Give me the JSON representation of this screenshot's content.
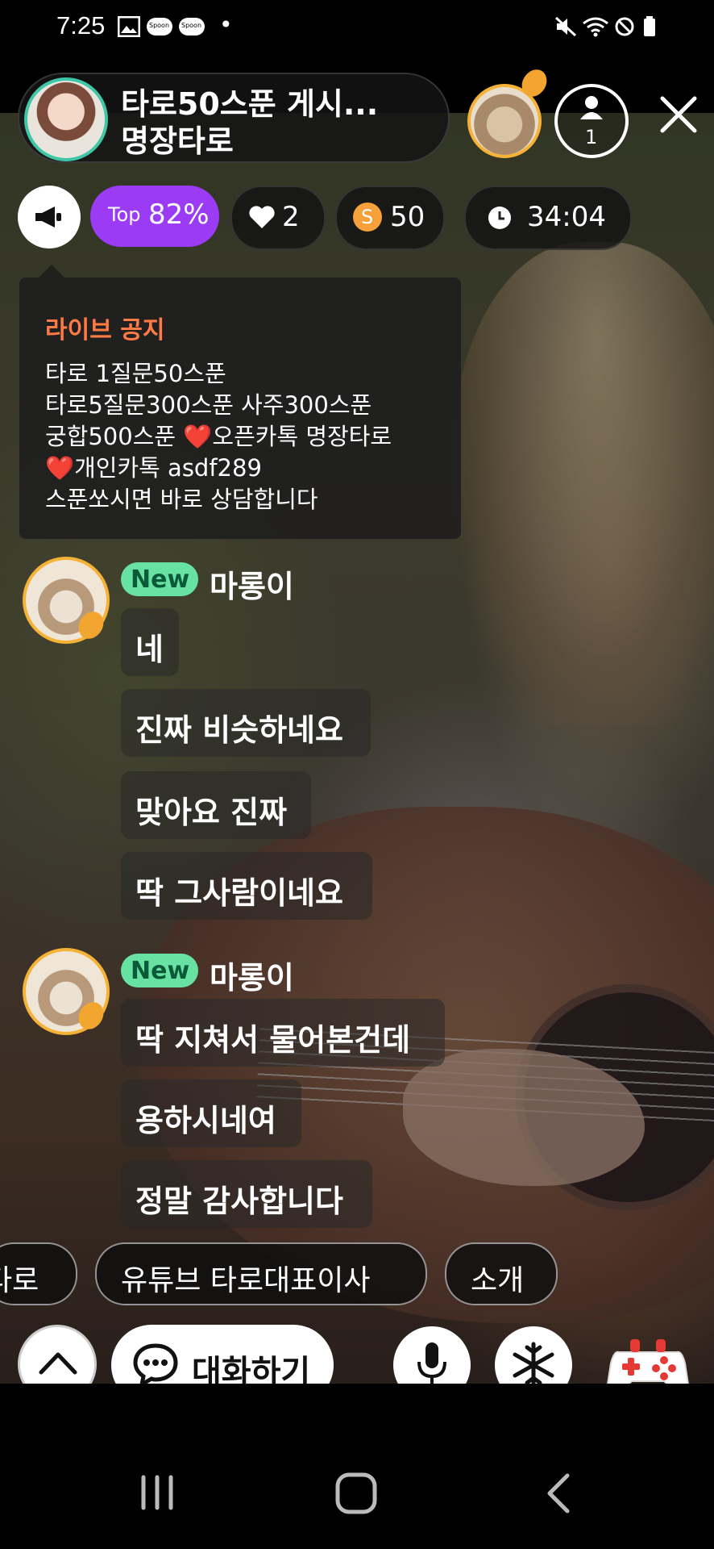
{
  "status_bar": {
    "time": "7:25",
    "dot": "•",
    "icons": [
      "image-icon",
      "spoon-notification-icon",
      "spoon-notification-icon",
      "mute-icon",
      "wifi-icon",
      "do-not-disturb-icon",
      "battery-icon"
    ],
    "app_badge_1": "Spoon",
    "app_badge_2": "Spoon"
  },
  "header": {
    "title_line1": "타로50스푼 게시...",
    "title_line2": "명장타로",
    "listener_count": "1"
  },
  "stats": {
    "top_label": "Top",
    "top_value": "82%",
    "likes": "2",
    "spoons": "50",
    "spoon_coin": "S",
    "timer": "34:04",
    "top_color": "#9b3bf5"
  },
  "notice": {
    "title": "라이브 공지",
    "lines": [
      "타로 1질문50스푼",
      "타로5질문300스푼 사주300스푼",
      "궁합500스푼 ❤️오픈카톡 명장타로",
      "❤️개인카톡 asdf289",
      "스푼쏘시면 바로 상담합니다"
    ]
  },
  "chat": [
    {
      "badge": "New",
      "name": "마롱이",
      "messages": [
        "네",
        "진짜 비슷하네요",
        "맞아요 진짜",
        "딱 그사람이네요"
      ]
    },
    {
      "badge": "New",
      "name": "마롱이",
      "messages": [
        "딱 지쳐서 물어본건데",
        "용하시네여",
        "정말 감사합니다"
      ]
    }
  ],
  "quick_replies": [
    "타로",
    "유튜브 타로대표이사",
    "소개"
  ],
  "bottom_bar": {
    "chat_label": "대화하기"
  }
}
